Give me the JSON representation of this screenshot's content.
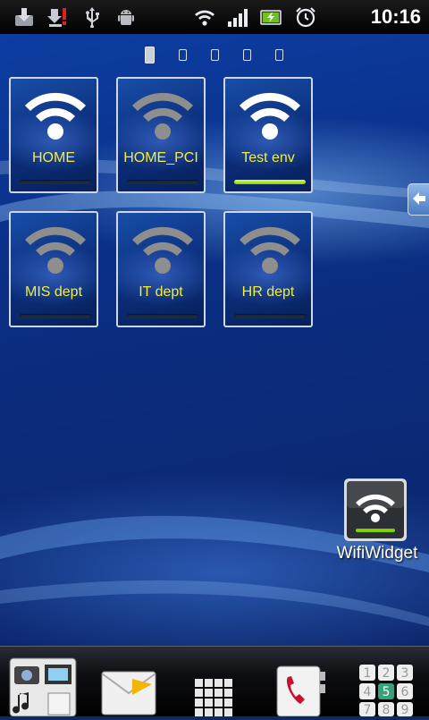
{
  "status_bar": {
    "time": "10:16",
    "icons": [
      "download-icon",
      "download-error-icon",
      "usb-icon",
      "android-debug-icon",
      "wifi-signal-icon",
      "cell-signal-icon",
      "battery-icon",
      "alarm-clock-icon"
    ]
  },
  "pager": {
    "pages": 5,
    "active_index": 0
  },
  "wifi_tiles": [
    {
      "label": "HOME",
      "connected": false,
      "signal_fill": 0
    },
    {
      "label": "HOME_PCI",
      "connected": false,
      "signal_fill": 0
    },
    {
      "label": "Test env",
      "connected": true,
      "signal_fill": 1.0
    },
    {
      "label": "MIS dept",
      "connected": false,
      "signal_fill": 0
    },
    {
      "label": "IT dept",
      "connected": false,
      "signal_fill": 0
    },
    {
      "label": "HR dept",
      "connected": false,
      "signal_fill": 0
    }
  ],
  "shortcut": {
    "label": "WifiWidget",
    "icon": "wifi-icon"
  },
  "dock": {
    "items": [
      "media-icon",
      "messaging-icon",
      "apps-grid-icon",
      "phone-contacts-icon",
      "dialer-icon"
    ]
  },
  "colors": {
    "tile_label": "#f2ee3a",
    "wifi_active": "#ffffff",
    "wifi_inactive": "#9a9a9a",
    "signal_bar": "#a6e000"
  }
}
